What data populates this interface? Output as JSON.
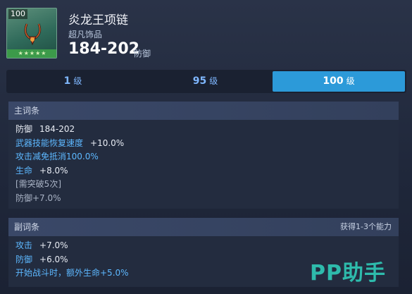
{
  "item": {
    "level_badge": "100",
    "stars": "★★★★★",
    "name": "炎龙王项链",
    "rarity": "超凡饰品",
    "stat_value": "184-202",
    "stat_label": "防御"
  },
  "level_tabs": [
    {
      "num": "1",
      "unit": "级",
      "active": false
    },
    {
      "num": "95",
      "unit": "级",
      "active": false
    },
    {
      "num": "100",
      "unit": "级",
      "active": true
    }
  ],
  "main_affix": {
    "title": "主词条",
    "rows": [
      {
        "key": "防御",
        "value": "184-202"
      },
      {
        "key": "武器技能恢复速度",
        "value": "+10.0%"
      },
      {
        "key": "攻击减免抵消100.0%",
        "value": ""
      },
      {
        "key": "生命",
        "value": "+8.0%"
      },
      {
        "key": "[需突破5次]",
        "value": ""
      },
      {
        "key": "防御+7.0%",
        "value": ""
      }
    ]
  },
  "sub_affix": {
    "title": "副词条",
    "note": "获得1-3个能力",
    "rows": [
      {
        "key": "攻击",
        "value": "+7.0%"
      },
      {
        "key": "防御",
        "value": "+6.0%"
      },
      {
        "key": "开始战斗时，额外生命+5.0%",
        "value": ""
      }
    ]
  },
  "watermark": "PP助手",
  "colors": {
    "accent_tab": "#2c9ad9",
    "blue_text": "#5db8ff",
    "watermark": "#2fc3b2"
  }
}
